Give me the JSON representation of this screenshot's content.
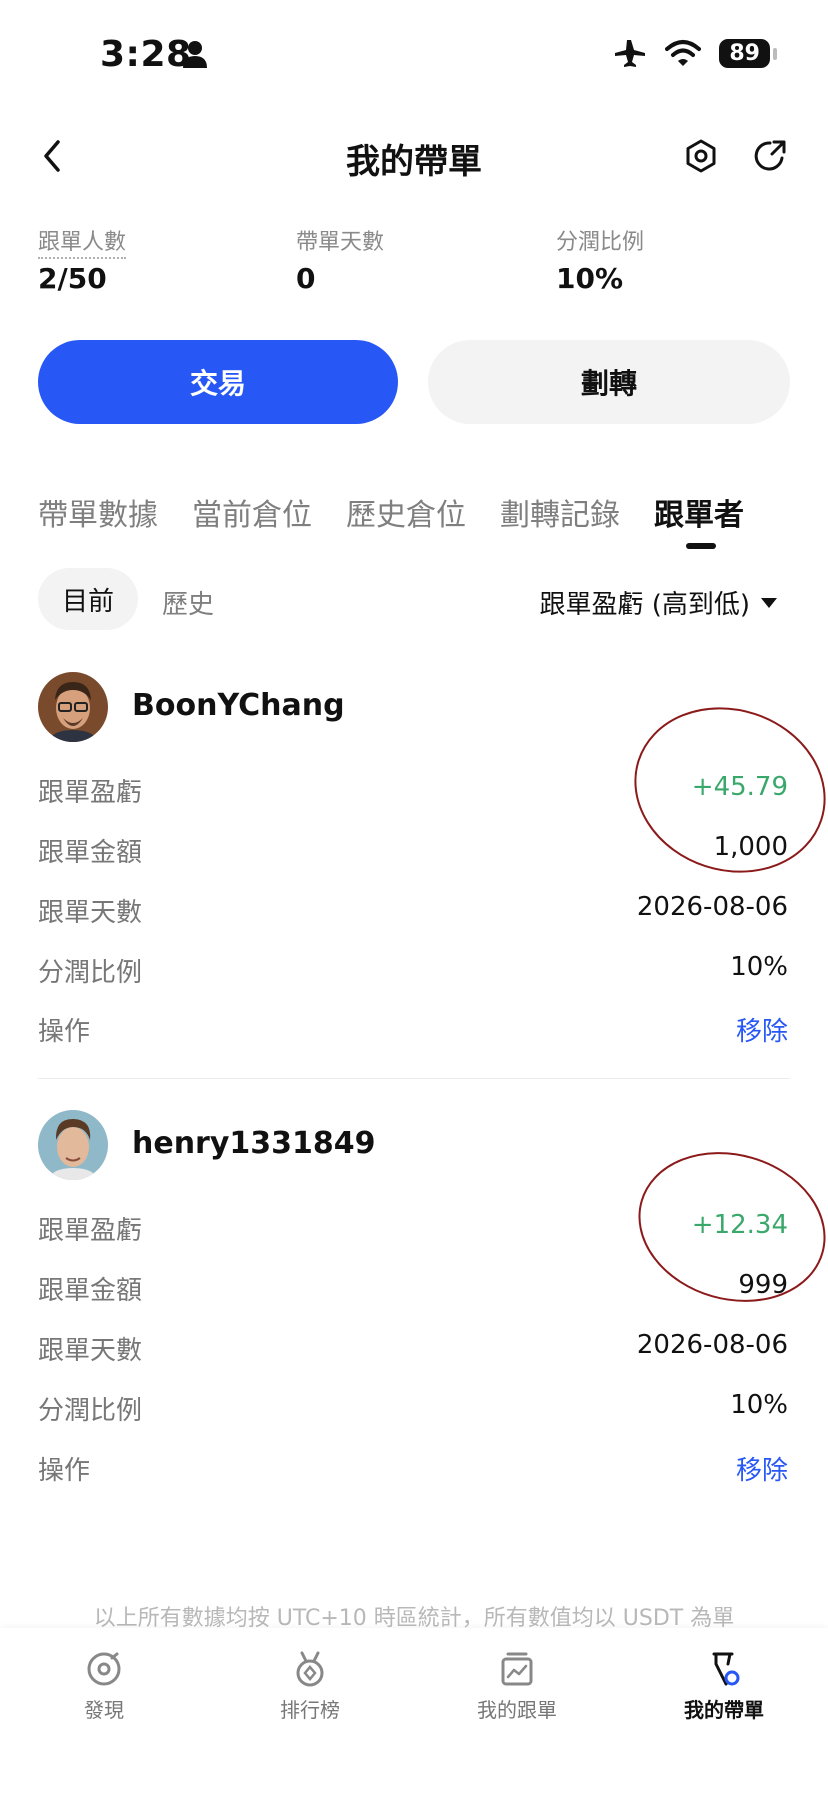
{
  "status_bar": {
    "time": "3:28",
    "battery": "89"
  },
  "header": {
    "title": "我的帶單"
  },
  "stats": [
    {
      "label": "跟單人數",
      "value": "2/50"
    },
    {
      "label": "帶單天數",
      "value": "0"
    },
    {
      "label": "分潤比例",
      "value": "10%"
    }
  ],
  "buttons": {
    "trade": "交易",
    "transfer": "劃轉"
  },
  "tabs": [
    "帶單數據",
    "當前倉位",
    "歷史倉位",
    "劃轉記錄",
    "跟單者"
  ],
  "subtabs": {
    "current": "目前",
    "history": "歷史"
  },
  "sort": {
    "label": "跟單盈虧 (高到低)"
  },
  "followers": [
    {
      "username": "BoonYChang",
      "rows": [
        {
          "label": "跟單盈虧",
          "value": "+45.79"
        },
        {
          "label": "跟單金額",
          "value": "1,000"
        },
        {
          "label": "跟單天數",
          "value": "2026-08-06"
        },
        {
          "label": "分潤比例",
          "value": "10%"
        },
        {
          "label": "操作",
          "value": "移除"
        }
      ]
    },
    {
      "username": "henry1331849",
      "rows": [
        {
          "label": "跟單盈虧",
          "value": "+12.34"
        },
        {
          "label": "跟單金額",
          "value": "999"
        },
        {
          "label": "跟單天數",
          "value": "2026-08-06"
        },
        {
          "label": "分潤比例",
          "value": "10%"
        },
        {
          "label": "操作",
          "value": "移除"
        }
      ]
    }
  ],
  "footnote": "以上所有數據均按 UTC+10 時區統計，所有數值均以 USDT 為單",
  "bottom_nav": [
    {
      "label": "發現",
      "icon": "discover-icon"
    },
    {
      "label": "排行榜",
      "icon": "medal-icon"
    },
    {
      "label": "我的跟單",
      "icon": "chart-board-icon"
    },
    {
      "label": "我的帶單",
      "icon": "lead-trade-icon"
    }
  ],
  "colors": {
    "accent": "#2758f6",
    "profit": "#3aa86b",
    "annotation": "#8b1a1a"
  }
}
